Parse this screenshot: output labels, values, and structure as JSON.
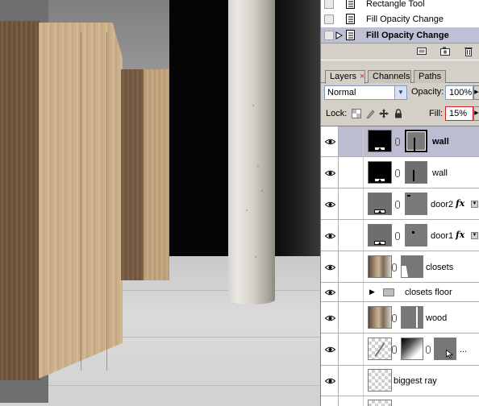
{
  "history": {
    "items": [
      {
        "label": "Rectangle Tool",
        "selected": false,
        "icon": "history-state-icon"
      },
      {
        "label": "Fill Opacity Change",
        "selected": false,
        "icon": "history-state-icon"
      },
      {
        "label": "Fill Opacity Change",
        "selected": true,
        "icon": "history-state-icon"
      }
    ],
    "toolbar_icons": [
      "new-document-from-state-icon",
      "new-snapshot-icon",
      "trash-icon"
    ]
  },
  "layers_panel": {
    "tabs": [
      {
        "label": "Layers",
        "close": "×",
        "active": true
      },
      {
        "label": "Channels",
        "active": false
      },
      {
        "label": "Paths",
        "active": false
      }
    ],
    "blend_mode": "Normal",
    "opacity_label": "Opacity:",
    "opacity": "100%",
    "lock_label": "Lock:",
    "lock_icons": [
      "lock-transparency-icon",
      "lock-image-icon",
      "lock-position-icon",
      "lock-all-icon"
    ],
    "fill_label": "Fill:",
    "fill": "15%",
    "layers": [
      {
        "name": "wall",
        "selected": true,
        "thumb": "black",
        "fx": false
      },
      {
        "name": "wall",
        "selected": false,
        "thumb": "black",
        "fx": false
      },
      {
        "name": "door2",
        "selected": false,
        "thumb": "gray",
        "fx": true,
        "fx_label": "fx"
      },
      {
        "name": "door1",
        "selected": false,
        "thumb": "gray",
        "fx": true,
        "fx_label": "fx"
      },
      {
        "name": "closets",
        "selected": false,
        "thumb": "photo",
        "fx": false
      },
      {
        "name": "closets floor",
        "selected": false,
        "thumb": "folder",
        "fx": false
      },
      {
        "name": "wood",
        "selected": false,
        "thumb": "photo",
        "fx": false
      },
      {
        "name": "...",
        "selected": false,
        "thumb": "checker",
        "fx": false
      },
      {
        "name": "biggest ray",
        "selected": false,
        "thumb": "checker",
        "fx": false
      }
    ]
  },
  "colors": {
    "panel_bg": "#d4d0c8",
    "selection": "#bcbdd3",
    "fill_border": "#d21f1f"
  }
}
